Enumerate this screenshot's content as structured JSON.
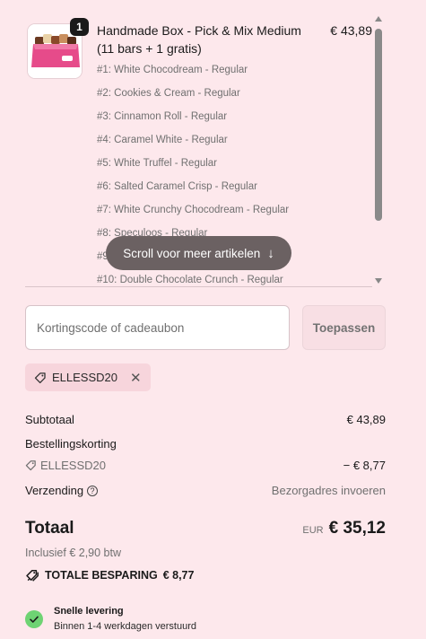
{
  "product": {
    "quantity": "1",
    "title_line1": "Handmade Box - Pick & Mix Medium",
    "title_line2": "(11 bars + 1 gratis)",
    "price": "€ 43,89",
    "variants": [
      "#1: White Chocodream - Regular",
      "#2: Cookies & Cream - Regular",
      "#3: Cinnamon Roll - Regular",
      "#4: Caramel White - Regular",
      "#5: White Truffel - Regular",
      "#6: Salted Caramel Crisp - Regular",
      "#7: White Crunchy Chocodream - Regular",
      "#8: Speculoos - Regular",
      "#9",
      "#10: Double Chocolate Crunch - Regular"
    ]
  },
  "scroll_hint": {
    "label": "Scroll voor meer artikelen",
    "icon": "arrow-down-icon"
  },
  "discount": {
    "placeholder": "Kortingscode of cadeaubon",
    "value": "",
    "apply_label": "Toepassen",
    "applied_code": "ELLESSD20"
  },
  "summary": {
    "subtotal_label": "Subtotaal",
    "subtotal_value": "€ 43,89",
    "order_discount_label": "Bestellingskorting",
    "order_discount_code": "ELLESSD20",
    "order_discount_value": "− € 8,77",
    "shipping_label": "Verzending",
    "shipping_value": "Bezorgadres invoeren",
    "total_label": "Totaal",
    "total_currency": "EUR",
    "total_value": "€ 35,12",
    "tax_note": "Inclusief € 2,90 btw",
    "savings_label": "TOTALE BESPARING",
    "savings_value": "€ 8,77"
  },
  "delivery": {
    "title": "Snelle levering",
    "subtitle": "Binnen 1-4 werkdagen verstuurd"
  },
  "colors": {
    "background": "#fde8ec",
    "chip": "#f7d5dc",
    "check": "#6ed373",
    "pill": "#6b6162"
  }
}
